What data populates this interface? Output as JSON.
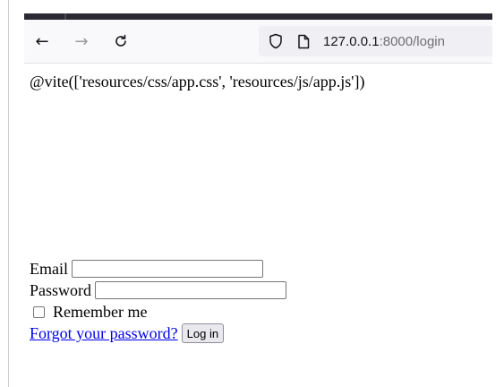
{
  "browser": {
    "back_icon": "arrow-left-icon",
    "forward_icon": "arrow-right-icon",
    "reload_icon": "reload-icon",
    "url_host": "127.0.0.1",
    "url_path": ":8000/login"
  },
  "page": {
    "vite_directive": "@vite(['resources/css/app.css', 'resources/js/app.js'])"
  },
  "form": {
    "email_label": "Email",
    "email_value": "",
    "password_label": "Password",
    "password_value": "",
    "remember_label": "Remember me",
    "remember_checked": false,
    "forgot_link": "Forgot your password?",
    "login_button": "Log in"
  },
  "colors": {
    "link": "#0000ee",
    "tab_strip": "#2b2a33",
    "toolbar": "#f9f9fb"
  }
}
